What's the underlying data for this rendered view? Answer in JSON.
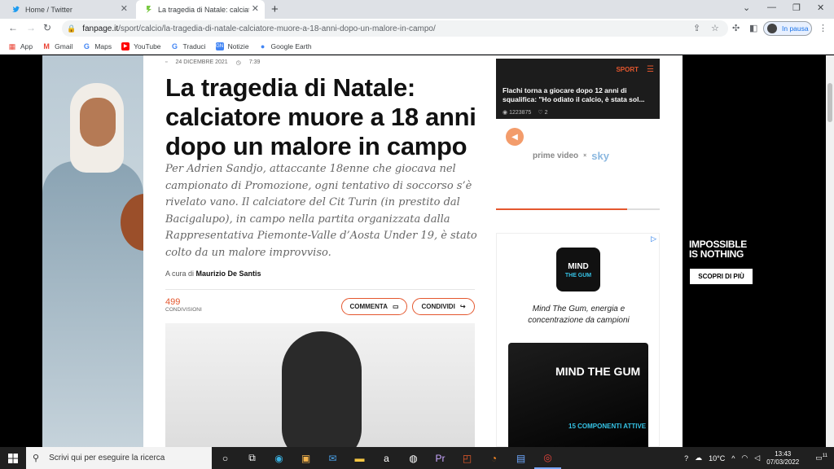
{
  "browser": {
    "tabs": [
      {
        "title": "Home / Twitter",
        "icon": "twitter-icon"
      },
      {
        "title": "La tragedia di Natale: calciatore muore",
        "icon": "fanpage-icon"
      }
    ],
    "url_host": "fanpage.it",
    "url_path": "/sport/calcio/la-tragedia-di-natale-calciatore-muore-a-18-anni-dopo-un-malore-in-campo/",
    "profile_label": "In pausa",
    "bookmarks": [
      {
        "label": "App",
        "icon": "apps-grid-icon"
      },
      {
        "label": "Gmail",
        "icon": "gmail-icon"
      },
      {
        "label": "Maps",
        "icon": "google-g-icon"
      },
      {
        "label": "YouTube",
        "icon": "youtube-icon"
      },
      {
        "label": "Traduci",
        "icon": "google-g-icon"
      },
      {
        "label": "Notizie",
        "icon": "news-icon"
      },
      {
        "label": "Google Earth",
        "icon": "earth-icon"
      }
    ]
  },
  "article": {
    "date": "24 DICEMBRE 2021",
    "time": "7:39",
    "headline": "La tragedia di Natale: calciatore muore a 18 anni dopo un malore in campo",
    "summary": "Per Adrien Sandjo, attaccante 18enne che giocava nel campionato di Promozione, ogni tentativo di soccorso s’è rivelato vano. Il calciatore del Cit Turin (in prestito dal Bacigalupo), in campo nella partita organizzata dalla Rappresentativa Piemonte-Valle d’Aosta Under 19, è stato colto da un malore improvviso.",
    "byline_prefix": "A cura di",
    "author": "Maurizio De Santis",
    "shares_count": "499",
    "shares_label": "CONDIVISIONI",
    "comment_label": "COMMENTA",
    "share_label": "CONDIVIDI"
  },
  "sidebar": {
    "section_tag": "SPORT",
    "card_title": "Flachi torna a giocare dopo 12 anni di squalifica: \"Ho odiato il calcio, è stata sol...",
    "views": "1223875",
    "likes": "2",
    "partner_1": "prime video",
    "partner_sep": "×",
    "partner_2": "sky",
    "progress_fraction": 0.8,
    "ad_logo_line1": "MIND",
    "ad_logo_line2": "THE GUM",
    "ad_copy": "Mind The Gum, energia e concentrazione da campioni",
    "ad_pack_text": "MIND THE GUM",
    "ad_pack_sub": "15 COMPONENTI ATTIVE"
  },
  "right_ad": {
    "slogan_line1": "IMPOSSIBLE",
    "slogan_line2": "IS NOTHING",
    "button": "SCOPRI DI PIÙ"
  },
  "taskbar": {
    "search_placeholder": "Scrivi qui per eseguire la ricerca",
    "temperature": "10°C",
    "time": "13:43",
    "date": "07/03/2022",
    "notifications": "11"
  },
  "colors": {
    "accent": "#e4572e",
    "tab_bar": "#dee1e6",
    "sport_card_bg": "#1c1c1c"
  }
}
